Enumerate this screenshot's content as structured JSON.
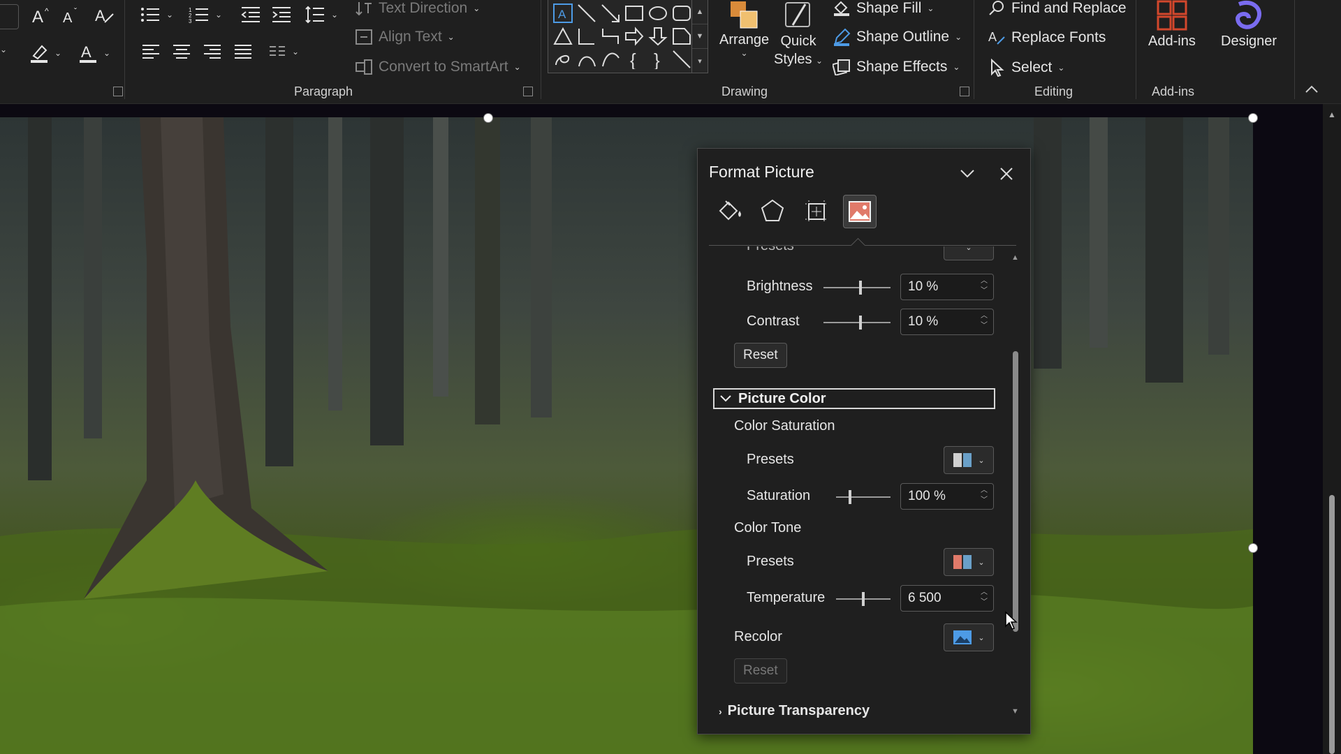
{
  "ribbon": {
    "font": {
      "grow_icon": "increase-font-size-icon",
      "shrink_icon": "decrease-font-size-icon",
      "clear_icon": "clear-formatting-icon",
      "highlight_icon": "highlighter-icon",
      "color_icon": "font-color-icon"
    },
    "paragraph": {
      "label": "Paragraph",
      "text_direction": "Text Direction",
      "align_text": "Align Text",
      "convert_smartart": "Convert to SmartArt"
    },
    "drawing": {
      "label": "Drawing",
      "arrange": "Arrange",
      "quick_styles_1": "Quick",
      "quick_styles_2": "Styles",
      "shape_fill": "Shape Fill",
      "shape_outline": "Shape Outline",
      "shape_effects": "Shape Effects"
    },
    "editing": {
      "label": "Editing",
      "find_replace": "Find and Replace",
      "replace_fonts": "Replace Fonts",
      "select": "Select"
    },
    "addins": {
      "label": "Add-ins",
      "addins_btn": "Add-ins",
      "designer": "Designer"
    }
  },
  "pane": {
    "title": "Format Picture",
    "tabs": [
      "fill-line-icon",
      "effects-icon",
      "size-properties-icon",
      "picture-icon"
    ],
    "presets_top_label": "Presets",
    "brightness": {
      "label": "Brightness",
      "value": "10 %",
      "level": 0.55
    },
    "contrast": {
      "label": "Contrast",
      "value": "10 %",
      "level": 0.55
    },
    "reset_1": "Reset",
    "picture_color": {
      "header": "Picture Color"
    },
    "color_saturation": {
      "label": "Color Saturation",
      "presets": "Presets",
      "saturation_label": "Saturation",
      "saturation_value": "100 %",
      "saturation_level": 0.25
    },
    "color_tone": {
      "label": "Color Tone",
      "presets": "Presets",
      "temperature_label": "Temperature",
      "temperature_value": "6 500",
      "temperature_level": 0.5
    },
    "recolor": "Recolor",
    "reset_2": "Reset",
    "picture_transparency": "Picture Transparency"
  }
}
